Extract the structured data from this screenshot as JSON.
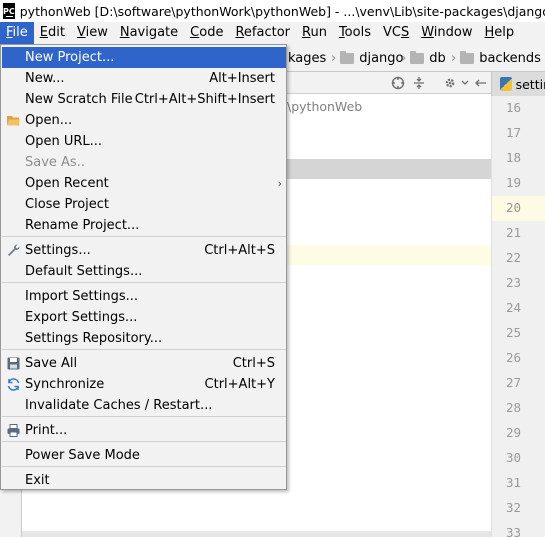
{
  "window": {
    "title": "pythonWeb [D:\\software\\pythonWork\\pythonWeb] - ...\\venv\\Lib\\site-packages\\django\\db"
  },
  "menubar": [
    {
      "label": "File",
      "mnemonic": "F",
      "rest": "ile",
      "active": true
    },
    {
      "label": "Edit",
      "mnemonic": "E",
      "rest": "dit"
    },
    {
      "label": "View",
      "mnemonic": "V",
      "rest": "iew"
    },
    {
      "label": "Navigate",
      "mnemonic": "N",
      "rest": "avigate"
    },
    {
      "label": "Code",
      "mnemonic": "C",
      "rest": "ode"
    },
    {
      "label": "Refactor",
      "mnemonic": "R",
      "rest": "efactor"
    },
    {
      "label": "Run",
      "mnemonic": "R",
      "rest": "un"
    },
    {
      "label": "Tools",
      "mnemonic": "T",
      "rest": "ools"
    },
    {
      "label": "VCS",
      "mnemonic": "S",
      "rest": "VC"
    },
    {
      "label": "Window",
      "mnemonic": "W",
      "rest": "indow"
    },
    {
      "label": "Help",
      "mnemonic": "H",
      "rest": "elp"
    }
  ],
  "breadcrumbs": [
    "kages",
    "django",
    "db",
    "backends"
  ],
  "project": {
    "path_text": "\\pythonWeb"
  },
  "editor_tab": {
    "label": "settin"
  },
  "gutter": {
    "line_numbers": [
      "16",
      "17",
      "18",
      "19",
      "20",
      "21",
      "22",
      "23",
      "24",
      "25",
      "26",
      "27",
      "28",
      "29",
      "30",
      "31",
      "32",
      "33"
    ]
  },
  "file_menu": {
    "items": [
      {
        "label": "New Project...",
        "shortcut": "",
        "selected": true
      },
      {
        "label": "New...",
        "shortcut": "Alt+Insert"
      },
      {
        "label": "New Scratch File",
        "shortcut": "Ctrl+Alt+Shift+Insert"
      },
      {
        "label": "Open...",
        "shortcut": "",
        "icon": "folder-open-icon"
      },
      {
        "label": "Open URL...",
        "shortcut": ""
      },
      {
        "label": "Save As..",
        "shortcut": "",
        "disabled": true
      },
      {
        "label": "Open Recent",
        "shortcut": "",
        "submenu": true
      },
      {
        "label": "Close Project",
        "shortcut": ""
      },
      {
        "label": "Rename Project...",
        "shortcut": ""
      },
      {
        "label": "Settings...",
        "shortcut": "Ctrl+Alt+S",
        "icon": "wrench-icon"
      },
      {
        "label": "Default Settings...",
        "shortcut": ""
      },
      {
        "label": "Import Settings...",
        "shortcut": ""
      },
      {
        "label": "Export Settings...",
        "shortcut": ""
      },
      {
        "label": "Settings Repository...",
        "shortcut": ""
      },
      {
        "label": "Save All",
        "shortcut": "Ctrl+S",
        "icon": "save-icon"
      },
      {
        "label": "Synchronize",
        "shortcut": "Ctrl+Alt+Y",
        "icon": "sync-icon"
      },
      {
        "label": "Invalidate Caches / Restart...",
        "shortcut": ""
      },
      {
        "label": "Print...",
        "shortcut": "",
        "icon": "printer-icon"
      },
      {
        "label": "Power Save Mode",
        "shortcut": ""
      },
      {
        "label": "Exit",
        "shortcut": ""
      }
    ]
  },
  "colors": {
    "selection": "#2f65ca",
    "menu_bg": "#f2f2f2",
    "current_line": "#fefce5"
  }
}
